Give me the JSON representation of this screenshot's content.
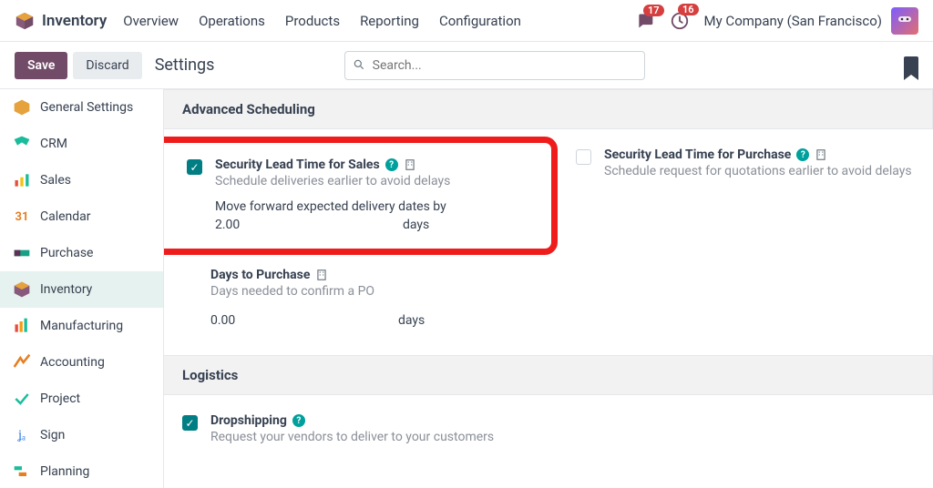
{
  "brand": "Inventory",
  "nav": [
    "Overview",
    "Operations",
    "Products",
    "Reporting",
    "Configuration"
  ],
  "chat_badge": "17",
  "clock_badge": "16",
  "company": "My Company (San Francisco)",
  "toolbar": {
    "save": "Save",
    "discard": "Discard",
    "title": "Settings",
    "search_ph": "Search..."
  },
  "sidebar": [
    {
      "label": "General Settings"
    },
    {
      "label": "CRM"
    },
    {
      "label": "Sales"
    },
    {
      "label": "Calendar"
    },
    {
      "label": "Purchase"
    },
    {
      "label": "Inventory"
    },
    {
      "label": "Manufacturing"
    },
    {
      "label": "Accounting"
    },
    {
      "label": "Project"
    },
    {
      "label": "Sign"
    },
    {
      "label": "Planning"
    }
  ],
  "sections": {
    "adv": {
      "title": "Advanced Scheduling",
      "sales": {
        "title": "Security Lead Time for Sales",
        "sub": "Schedule deliveries earlier to avoid delays",
        "extra": "Move forward expected delivery dates by",
        "val": "2.00",
        "unit": "days"
      },
      "purchase": {
        "title": "Security Lead Time for Purchase",
        "sub": "Schedule request for quotations earlier to avoid delays"
      },
      "days": {
        "title": "Days to Purchase",
        "sub": "Days needed to confirm a PO",
        "val": "0.00",
        "unit": "days"
      }
    },
    "log": {
      "title": "Logistics",
      "drop": {
        "title": "Dropshipping",
        "sub": "Request your vendors to deliver to your customers"
      }
    }
  }
}
